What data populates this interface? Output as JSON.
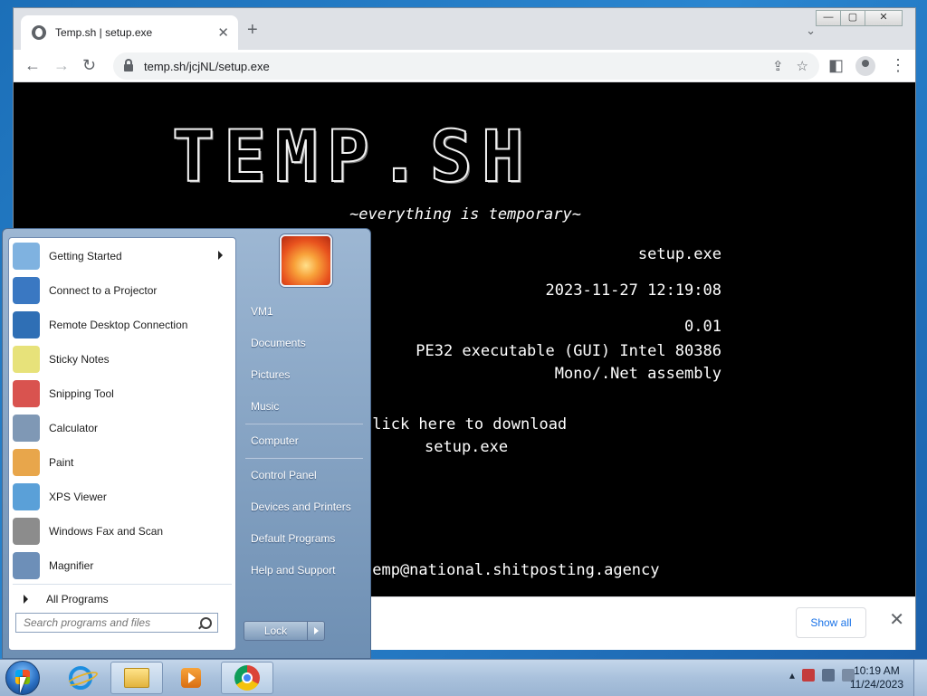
{
  "browser": {
    "tab_title": "Temp.sh | setup.exe",
    "tab_close": "✕",
    "new_tab": "+",
    "tab_menu": "⌄",
    "win_min": "—",
    "win_max": "▢",
    "win_close": "✕",
    "back": "←",
    "forward": "→",
    "reload": "↻",
    "url": "temp.sh/jcjNL/setup.exe",
    "share": "⇪",
    "star": "☆",
    "sidepanel": "◧",
    "menu": "⋮"
  },
  "page": {
    "logo": "TEMP.SH",
    "tagline": "~everything is temporary~",
    "filename": "setup.exe",
    "date": "2023-11-27 12:19:08",
    "size": "0.01",
    "type_line1": "PE32 executable (GUI) Intel 80386",
    "type_line2": "Mono/.Net assembly",
    "download_line1": "Click here to download",
    "download_line2": "setup.exe",
    "contact": "temp@national.shitposting.agency"
  },
  "download_bar": {
    "show_all": "Show all",
    "close": "✕"
  },
  "start_menu": {
    "programs": [
      {
        "label": "Getting Started",
        "icon": "getting-started-icon",
        "color": "#7fb2e0"
      },
      {
        "label": "Connect to a Projector",
        "icon": "projector-icon",
        "color": "#3a78c2"
      },
      {
        "label": "Remote Desktop Connection",
        "icon": "remote-desktop-icon",
        "color": "#2f6fb5"
      },
      {
        "label": "Sticky Notes",
        "icon": "sticky-notes-icon",
        "color": "#e7e27a"
      },
      {
        "label": "Snipping Tool",
        "icon": "snipping-tool-icon",
        "color": "#d9534f"
      },
      {
        "label": "Calculator",
        "icon": "calculator-icon",
        "color": "#7f98b5"
      },
      {
        "label": "Paint",
        "icon": "paint-icon",
        "color": "#e8a64b"
      },
      {
        "label": "XPS Viewer",
        "icon": "xps-viewer-icon",
        "color": "#5aa0d8"
      },
      {
        "label": "Windows Fax and Scan",
        "icon": "fax-scan-icon",
        "color": "#8c8c8c"
      },
      {
        "label": "Magnifier",
        "icon": "magnifier-icon",
        "color": "#6d8fb8"
      }
    ],
    "all_programs": "All Programs",
    "search_placeholder": "Search programs and files",
    "right_items": [
      "VM1",
      "Documents",
      "Pictures",
      "Music",
      "Computer",
      "Control Panel",
      "Devices and Printers",
      "Default Programs",
      "Help and Support"
    ],
    "lock": "Lock"
  },
  "taskbar": {
    "time": "10:19 AM",
    "date": "11/24/2023",
    "tray_arrow": "▴"
  }
}
